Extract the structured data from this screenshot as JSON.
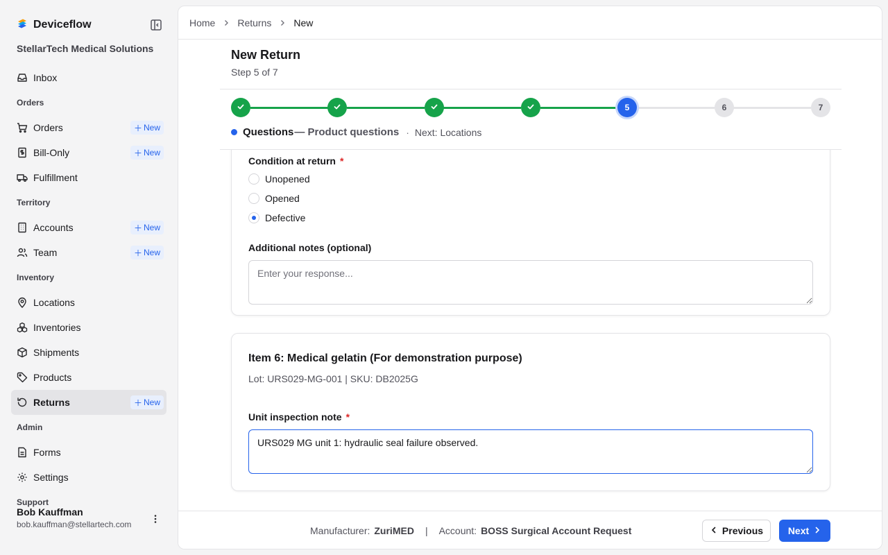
{
  "app": {
    "brand": "Deviceflow",
    "org": "StellarTech Medical Solutions"
  },
  "sidebar": {
    "inbox": "Inbox",
    "sections": {
      "orders": "Orders",
      "territory": "Territory",
      "inventory": "Inventory",
      "admin": "Admin",
      "support": "Support"
    },
    "items": {
      "orders": "Orders",
      "bill_only": "Bill-Only",
      "fulfillment": "Fulfillment",
      "accounts": "Accounts",
      "team": "Team",
      "locations": "Locations",
      "inventories": "Inventories",
      "shipments": "Shipments",
      "products": "Products",
      "returns": "Returns",
      "forms": "Forms",
      "settings": "Settings"
    },
    "new_label": "New"
  },
  "user": {
    "name": "Bob Kauffman",
    "email": "bob.kauffman@stellartech.com"
  },
  "breadcrumb": {
    "home": "Home",
    "returns": "Returns",
    "current": "New"
  },
  "page": {
    "title": "New Return",
    "step_text": "Step 5 of 7"
  },
  "stepper": {
    "current": 5,
    "total": 7,
    "step_6": "6",
    "step_7": "7",
    "step_5": "5",
    "caption_name": "Questions",
    "caption_desc": "— Product questions",
    "middot": "·",
    "next": "Next: Locations"
  },
  "form": {
    "condition_label": "Condition at return",
    "required_mark": "*",
    "options": [
      "Unopened",
      "Opened",
      "Defective"
    ],
    "selected_option": "Defective",
    "notes_label": "Additional notes (optional)",
    "notes_placeholder": "Enter your response..."
  },
  "item6": {
    "title": "Item 6: Medical gelatin (For demonstration purpose)",
    "meta": "Lot: URS029-MG-001 | SKU: DB2025G",
    "note_label": "Unit inspection note",
    "note_value": "URS029 MG unit 1: hydraulic seal failure observed."
  },
  "footer": {
    "manufacturer_label": "Manufacturer:",
    "manufacturer_value": "ZuriMED",
    "pipe": "|",
    "account_label": "Account:",
    "account_value": "BOSS Surgical Account Request",
    "previous": "Previous",
    "next": "Next"
  },
  "colors": {
    "accent": "#2563eb",
    "success": "#16a34a",
    "required": "#dc2626"
  }
}
